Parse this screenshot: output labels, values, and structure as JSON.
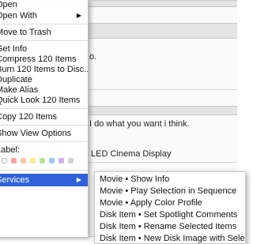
{
  "background": {
    "line1": "o.",
    "line2": "I do what you want i think.",
    "line3": "LED Cinema Display"
  },
  "menu": {
    "items": [
      {
        "label": "Open"
      },
      {
        "label": "Open With"
      },
      {
        "label": "Move to Trash"
      },
      {
        "label": "Get Info"
      },
      {
        "label": "Compress 120 Items"
      },
      {
        "label": "Burn 120 Items to Disc..."
      },
      {
        "label": "Duplicate"
      },
      {
        "label": "Make Alias"
      },
      {
        "label": "Quick Look 120 Items"
      },
      {
        "label": "Copy 120 Items"
      },
      {
        "label": "Show View Options"
      },
      {
        "label": "Label:"
      },
      {
        "label": "Services"
      }
    ],
    "label_colors": [
      "#f7a5a5",
      "#f9c79b",
      "#f7ee96",
      "#b7e59a",
      "#9fc8f0",
      "#cdb1e8",
      "#d0d0d0"
    ]
  },
  "submenu": {
    "items": [
      {
        "label": "Movie • Show Info"
      },
      {
        "label": "Movie • Play Selection in Sequence"
      },
      {
        "label": "Movie • Apply Color Profile"
      },
      {
        "label": "Disk Item • Set Spotlight Comments"
      },
      {
        "label": "Disk Item • Rename Selected Items"
      },
      {
        "label": "Disk Item • New Disk Image with Select"
      }
    ]
  },
  "colors": {
    "highlight": "#2f62d8"
  }
}
